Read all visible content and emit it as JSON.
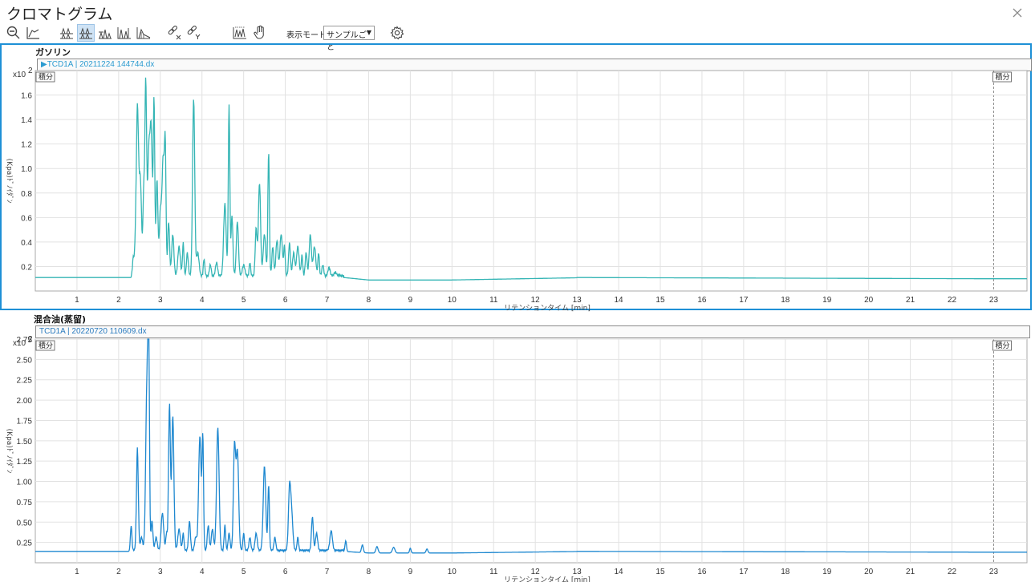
{
  "window": {
    "title": "クロマトグラム",
    "close_icon": "close-icon"
  },
  "toolbar": {
    "buttons": [
      "zoom-out-icon",
      "baseline-icon",
      "overlay-peaks-icon",
      "stacked-peaks-icon",
      "split-peaks-icon",
      "peak-label-icon",
      "area-icon",
      "link-x-icon",
      "link-y-icon",
      "chart-settings-icon",
      "hand-pan-icon"
    ],
    "mode_label": "表示モード",
    "mode_value": "サンプルごと",
    "settings_icon": "gear-icon"
  },
  "panels": [
    {
      "title": "ガソリン",
      "trace_label": "▶TCD1A | 20211224 144744.dx",
      "exponent": "x10",
      "exponent_power": "2",
      "integ_left": "積分",
      "integ_right": "積分",
      "ylabel": "(Kpa)ﾄﾞﾉｲﾀﾞﾝ",
      "xlabel": "リテンションタイム [min]",
      "color": "#35b5b5"
    },
    {
      "title": "混合油(蒸留)",
      "trace_label": "TCD1A | 20220720 110609.dx",
      "exponent": "x10",
      "exponent_power": "2",
      "integ_left": "積分",
      "integ_right": "積分",
      "ylabel": "(Kpa)ﾄﾞﾉｲﾀﾞﾝ",
      "xlabel": "リテンションタイム [min]",
      "color": "#1e88d0"
    }
  ],
  "chart_data": [
    {
      "type": "line",
      "name": "ガソリン",
      "xlabel": "リテンションタイム [min]",
      "ylabel": "",
      "xlim": [
        0,
        23.8
      ],
      "ylim": [
        0,
        1.8
      ],
      "x_ticks": [
        1,
        2,
        3,
        4,
        5,
        6,
        7,
        8,
        9,
        10,
        11,
        12,
        13,
        14,
        15,
        16,
        17,
        18,
        19,
        20,
        21,
        22,
        23
      ],
      "y_ticks": [
        0.2,
        0.4,
        0.6,
        0.8,
        1.0,
        1.2,
        1.4,
        1.6
      ],
      "y_tick_labels": [
        "0.2",
        "0.4",
        "0.6",
        "0.8",
        "1.0",
        "1.2",
        "1.4",
        "1.6"
      ],
      "baseline": 0.11,
      "baseline_after": 0.09,
      "peaks": [
        [
          2.35,
          0.25
        ],
        [
          2.4,
          0.3
        ],
        [
          2.45,
          1.45
        ],
        [
          2.52,
          0.9
        ],
        [
          2.6,
          0.7
        ],
        [
          2.65,
          1.7
        ],
        [
          2.72,
          1.0
        ],
        [
          2.78,
          1.3
        ],
        [
          2.85,
          1.5
        ],
        [
          2.92,
          0.9
        ],
        [
          3.0,
          0.6
        ],
        [
          3.07,
          1.07
        ],
        [
          3.12,
          1.02
        ],
        [
          3.2,
          0.55
        ],
        [
          3.3,
          0.45
        ],
        [
          3.45,
          0.35
        ],
        [
          3.55,
          0.38
        ],
        [
          3.65,
          0.3
        ],
        [
          3.8,
          1.55
        ],
        [
          3.9,
          0.3
        ],
        [
          4.05,
          0.25
        ],
        [
          4.2,
          0.2
        ],
        [
          4.35,
          0.22
        ],
        [
          4.55,
          0.7
        ],
        [
          4.65,
          1.5
        ],
        [
          4.72,
          0.6
        ],
        [
          4.85,
          0.55
        ],
        [
          5.0,
          0.2
        ],
        [
          5.15,
          0.22
        ],
        [
          5.3,
          0.5
        ],
        [
          5.38,
          0.87
        ],
        [
          5.5,
          0.45
        ],
        [
          5.6,
          1.13
        ],
        [
          5.7,
          0.35
        ],
        [
          5.8,
          0.4
        ],
        [
          5.9,
          0.45
        ],
        [
          5.98,
          0.35
        ],
        [
          6.1,
          0.38
        ],
        [
          6.2,
          0.3
        ],
        [
          6.3,
          0.35
        ],
        [
          6.4,
          0.28
        ],
        [
          6.5,
          0.3
        ],
        [
          6.6,
          0.45
        ],
        [
          6.7,
          0.35
        ],
        [
          6.8,
          0.3
        ],
        [
          6.9,
          0.2
        ],
        [
          7.05,
          0.18
        ],
        [
          7.2,
          0.14
        ],
        [
          7.3,
          0.12
        ]
      ]
    },
    {
      "type": "line",
      "name": "混合油(蒸留)",
      "xlabel": "リテンションタイム [min]",
      "ylabel": "",
      "xlim": [
        0,
        23.8
      ],
      "ylim": [
        0,
        2.75
      ],
      "x_ticks": [
        1,
        2,
        3,
        4,
        5,
        6,
        7,
        8,
        9,
        10,
        11,
        12,
        13,
        14,
        15,
        16,
        17,
        18,
        19,
        20,
        21,
        22,
        23
      ],
      "y_ticks": [
        0.25,
        0.5,
        0.75,
        1.0,
        1.25,
        1.5,
        1.75,
        2.0,
        2.25,
        2.5,
        2.75
      ],
      "y_tick_labels": [
        "0.25",
        "0.50",
        "0.75",
        "1.00",
        "1.25",
        "1.50",
        "1.75",
        "2.00",
        "2.25",
        "2.50",
        "2.75"
      ],
      "baseline": 0.14,
      "baseline_after": 0.12,
      "peaks": [
        [
          2.3,
          0.45
        ],
        [
          2.45,
          1.4
        ],
        [
          2.55,
          0.3
        ],
        [
          2.68,
          2.15
        ],
        [
          2.72,
          2.7
        ],
        [
          2.8,
          0.5
        ],
        [
          2.9,
          0.3
        ],
        [
          3.05,
          0.6
        ],
        [
          3.15,
          0.35
        ],
        [
          3.22,
          1.93
        ],
        [
          3.3,
          1.8
        ],
        [
          3.45,
          0.4
        ],
        [
          3.55,
          0.35
        ],
        [
          3.7,
          0.5
        ],
        [
          3.85,
          0.3
        ],
        [
          3.95,
          1.55
        ],
        [
          4.02,
          1.5
        ],
        [
          4.15,
          0.45
        ],
        [
          4.25,
          0.4
        ],
        [
          4.38,
          1.65
        ],
        [
          4.55,
          0.45
        ],
        [
          4.65,
          0.35
        ],
        [
          4.78,
          1.4
        ],
        [
          4.85,
          1.35
        ],
        [
          5.0,
          0.35
        ],
        [
          5.15,
          0.3
        ],
        [
          5.3,
          0.35
        ],
        [
          5.5,
          1.18
        ],
        [
          5.6,
          0.95
        ],
        [
          5.75,
          0.3
        ],
        [
          6.1,
          0.85
        ],
        [
          6.15,
          0.6
        ],
        [
          6.3,
          0.3
        ],
        [
          6.65,
          0.55
        ],
        [
          6.75,
          0.35
        ],
        [
          7.1,
          0.38
        ],
        [
          7.45,
          0.27
        ],
        [
          7.85,
          0.22
        ],
        [
          8.2,
          0.2
        ],
        [
          8.6,
          0.19
        ],
        [
          9.0,
          0.18
        ],
        [
          9.4,
          0.17
        ]
      ]
    }
  ]
}
